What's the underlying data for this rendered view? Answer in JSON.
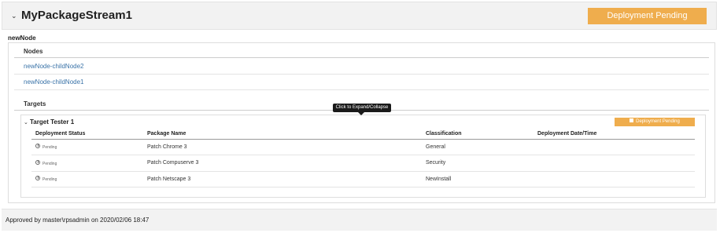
{
  "header": {
    "title": "MyPackageStream1",
    "deployment_status_button": "Deployment Pending"
  },
  "node": {
    "name": "newNode",
    "nodes_heading": "Nodes",
    "children": [
      {
        "label": "newNode-childNode2"
      },
      {
        "label": "newNode-childNode1"
      }
    ],
    "targets_heading": "Targets"
  },
  "tooltip": "Click to Expand/Collapse",
  "target": {
    "name": "Target Tester 1",
    "button": "Deployment Pending",
    "columns": {
      "status": "Deployment Status",
      "package": "Package Name",
      "classification": "Classification",
      "date": "Deployment Date/Time"
    },
    "rows": [
      {
        "status": "Pending",
        "package": "Patch Chrome 3",
        "classification": "General",
        "date": ""
      },
      {
        "status": "Pending",
        "package": "Patch Compuserve 3",
        "classification": "Security",
        "date": ""
      },
      {
        "status": "Pending",
        "package": "Patch Netscape 3",
        "classification": "NewInstall",
        "date": ""
      }
    ]
  },
  "footer": {
    "approved": "Approved by master\\rpsadmin on 2020/02/06 18:47"
  },
  "colors": {
    "accent": "#efad4d",
    "link": "#3a73a8",
    "header_bg": "#f2f2f2"
  }
}
